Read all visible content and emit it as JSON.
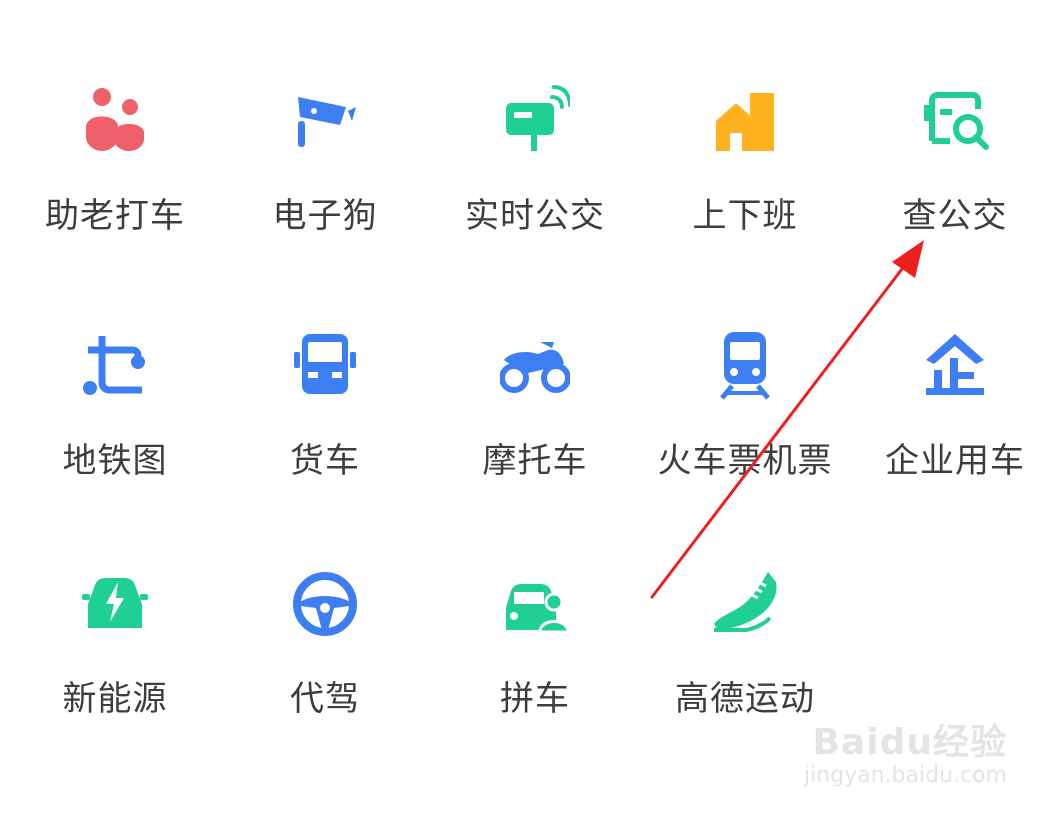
{
  "colors": {
    "coral": "#f0606b",
    "blue": "#3d7ff2",
    "green": "#1fcf95",
    "orange": "#ffb21f",
    "label": "#3d3d3d",
    "arrow": "#f01f1f"
  },
  "grid": {
    "items": [
      {
        "label": "助老打车",
        "icon": "elderly-couple-icon"
      },
      {
        "label": "电子狗",
        "icon": "speed-camera-icon"
      },
      {
        "label": "实时公交",
        "icon": "bus-stop-signal-icon"
      },
      {
        "label": "上下班",
        "icon": "commute-buildings-icon"
      },
      {
        "label": "查公交",
        "icon": "bus-search-icon"
      },
      {
        "label": "地铁图",
        "icon": "subway-map-icon"
      },
      {
        "label": "货车",
        "icon": "truck-icon"
      },
      {
        "label": "摩托车",
        "icon": "motorcycle-icon"
      },
      {
        "label": "火车票机票",
        "icon": "train-icon"
      },
      {
        "label": "企业用车",
        "icon": "enterprise-icon"
      },
      {
        "label": "新能源",
        "icon": "electric-car-icon"
      },
      {
        "label": "代驾",
        "icon": "steering-wheel-icon"
      },
      {
        "label": "拼车",
        "icon": "carpool-icon"
      },
      {
        "label": "高德运动",
        "icon": "running-shoe-icon"
      }
    ]
  },
  "watermark": {
    "main": "Baidu经验",
    "sub": "jingyan.baidu.com"
  },
  "annotation": {
    "type": "arrow",
    "target": "查公交"
  }
}
